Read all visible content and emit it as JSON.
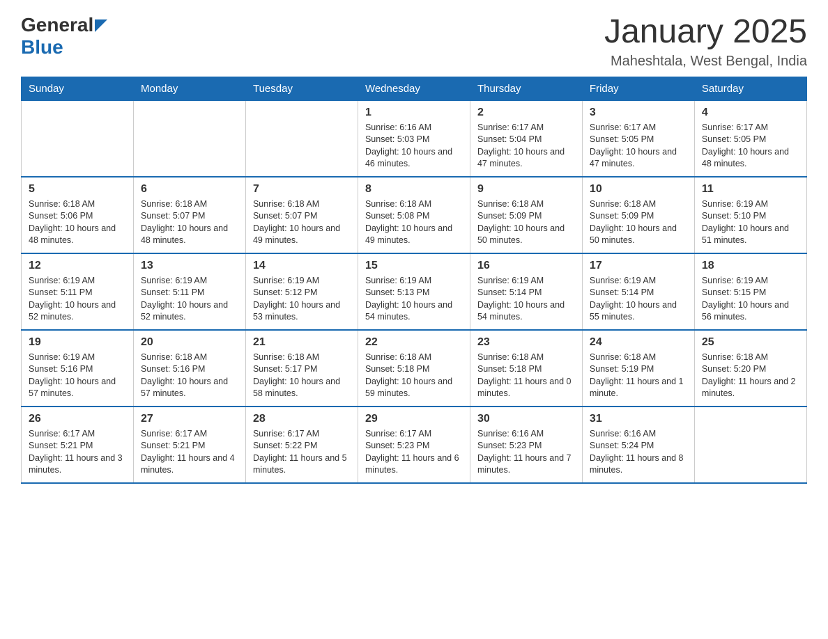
{
  "header": {
    "logo_general": "General",
    "logo_blue": "Blue",
    "title": "January 2025",
    "subtitle": "Maheshtala, West Bengal, India"
  },
  "calendar": {
    "days_of_week": [
      "Sunday",
      "Monday",
      "Tuesday",
      "Wednesday",
      "Thursday",
      "Friday",
      "Saturday"
    ],
    "weeks": [
      [
        {
          "day": "",
          "info": ""
        },
        {
          "day": "",
          "info": ""
        },
        {
          "day": "",
          "info": ""
        },
        {
          "day": "1",
          "info": "Sunrise: 6:16 AM\nSunset: 5:03 PM\nDaylight: 10 hours\nand 46 minutes."
        },
        {
          "day": "2",
          "info": "Sunrise: 6:17 AM\nSunset: 5:04 PM\nDaylight: 10 hours\nand 47 minutes."
        },
        {
          "day": "3",
          "info": "Sunrise: 6:17 AM\nSunset: 5:05 PM\nDaylight: 10 hours\nand 47 minutes."
        },
        {
          "day": "4",
          "info": "Sunrise: 6:17 AM\nSunset: 5:05 PM\nDaylight: 10 hours\nand 48 minutes."
        }
      ],
      [
        {
          "day": "5",
          "info": "Sunrise: 6:18 AM\nSunset: 5:06 PM\nDaylight: 10 hours\nand 48 minutes."
        },
        {
          "day": "6",
          "info": "Sunrise: 6:18 AM\nSunset: 5:07 PM\nDaylight: 10 hours\nand 48 minutes."
        },
        {
          "day": "7",
          "info": "Sunrise: 6:18 AM\nSunset: 5:07 PM\nDaylight: 10 hours\nand 49 minutes."
        },
        {
          "day": "8",
          "info": "Sunrise: 6:18 AM\nSunset: 5:08 PM\nDaylight: 10 hours\nand 49 minutes."
        },
        {
          "day": "9",
          "info": "Sunrise: 6:18 AM\nSunset: 5:09 PM\nDaylight: 10 hours\nand 50 minutes."
        },
        {
          "day": "10",
          "info": "Sunrise: 6:18 AM\nSunset: 5:09 PM\nDaylight: 10 hours\nand 50 minutes."
        },
        {
          "day": "11",
          "info": "Sunrise: 6:19 AM\nSunset: 5:10 PM\nDaylight: 10 hours\nand 51 minutes."
        }
      ],
      [
        {
          "day": "12",
          "info": "Sunrise: 6:19 AM\nSunset: 5:11 PM\nDaylight: 10 hours\nand 52 minutes."
        },
        {
          "day": "13",
          "info": "Sunrise: 6:19 AM\nSunset: 5:11 PM\nDaylight: 10 hours\nand 52 minutes."
        },
        {
          "day": "14",
          "info": "Sunrise: 6:19 AM\nSunset: 5:12 PM\nDaylight: 10 hours\nand 53 minutes."
        },
        {
          "day": "15",
          "info": "Sunrise: 6:19 AM\nSunset: 5:13 PM\nDaylight: 10 hours\nand 54 minutes."
        },
        {
          "day": "16",
          "info": "Sunrise: 6:19 AM\nSunset: 5:14 PM\nDaylight: 10 hours\nand 54 minutes."
        },
        {
          "day": "17",
          "info": "Sunrise: 6:19 AM\nSunset: 5:14 PM\nDaylight: 10 hours\nand 55 minutes."
        },
        {
          "day": "18",
          "info": "Sunrise: 6:19 AM\nSunset: 5:15 PM\nDaylight: 10 hours\nand 56 minutes."
        }
      ],
      [
        {
          "day": "19",
          "info": "Sunrise: 6:19 AM\nSunset: 5:16 PM\nDaylight: 10 hours\nand 57 minutes."
        },
        {
          "day": "20",
          "info": "Sunrise: 6:18 AM\nSunset: 5:16 PM\nDaylight: 10 hours\nand 57 minutes."
        },
        {
          "day": "21",
          "info": "Sunrise: 6:18 AM\nSunset: 5:17 PM\nDaylight: 10 hours\nand 58 minutes."
        },
        {
          "day": "22",
          "info": "Sunrise: 6:18 AM\nSunset: 5:18 PM\nDaylight: 10 hours\nand 59 minutes."
        },
        {
          "day": "23",
          "info": "Sunrise: 6:18 AM\nSunset: 5:18 PM\nDaylight: 11 hours\nand 0 minutes."
        },
        {
          "day": "24",
          "info": "Sunrise: 6:18 AM\nSunset: 5:19 PM\nDaylight: 11 hours\nand 1 minute."
        },
        {
          "day": "25",
          "info": "Sunrise: 6:18 AM\nSunset: 5:20 PM\nDaylight: 11 hours\nand 2 minutes."
        }
      ],
      [
        {
          "day": "26",
          "info": "Sunrise: 6:17 AM\nSunset: 5:21 PM\nDaylight: 11 hours\nand 3 minutes."
        },
        {
          "day": "27",
          "info": "Sunrise: 6:17 AM\nSunset: 5:21 PM\nDaylight: 11 hours\nand 4 minutes."
        },
        {
          "day": "28",
          "info": "Sunrise: 6:17 AM\nSunset: 5:22 PM\nDaylight: 11 hours\nand 5 minutes."
        },
        {
          "day": "29",
          "info": "Sunrise: 6:17 AM\nSunset: 5:23 PM\nDaylight: 11 hours\nand 6 minutes."
        },
        {
          "day": "30",
          "info": "Sunrise: 6:16 AM\nSunset: 5:23 PM\nDaylight: 11 hours\nand 7 minutes."
        },
        {
          "day": "31",
          "info": "Sunrise: 6:16 AM\nSunset: 5:24 PM\nDaylight: 11 hours\nand 8 minutes."
        },
        {
          "day": "",
          "info": ""
        }
      ]
    ]
  }
}
